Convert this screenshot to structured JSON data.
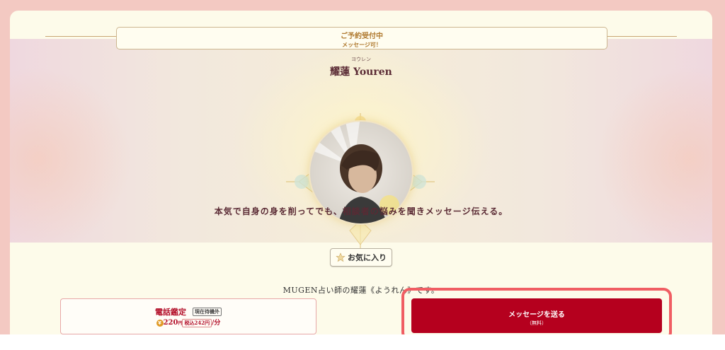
{
  "status": {
    "main": "ご予約受付中",
    "sub": "メッセージ可！"
  },
  "profile": {
    "ruby": "ヨウレン",
    "name": "耀蓮 Youren",
    "tagline": "本気で自身の身を削ってでも、相談者の悩みを聞きメッセージ伝える。"
  },
  "favorite": {
    "label": "お気に入り",
    "icon": "star-icon"
  },
  "intro": "MUGEN占い師の耀蓮《ようれん》です。",
  "phone": {
    "title": "電話鑑定",
    "badge": "現在待機外",
    "coin": "¥",
    "price": "220",
    "price_unit": "円",
    "tax": "税込242円",
    "per": "/分"
  },
  "message_button": {
    "label": "メッセージを送る",
    "sub": "（無料）"
  },
  "colors": {
    "accent": "#b5001e",
    "highlight": "#f05d63",
    "gold": "#c9a574"
  }
}
